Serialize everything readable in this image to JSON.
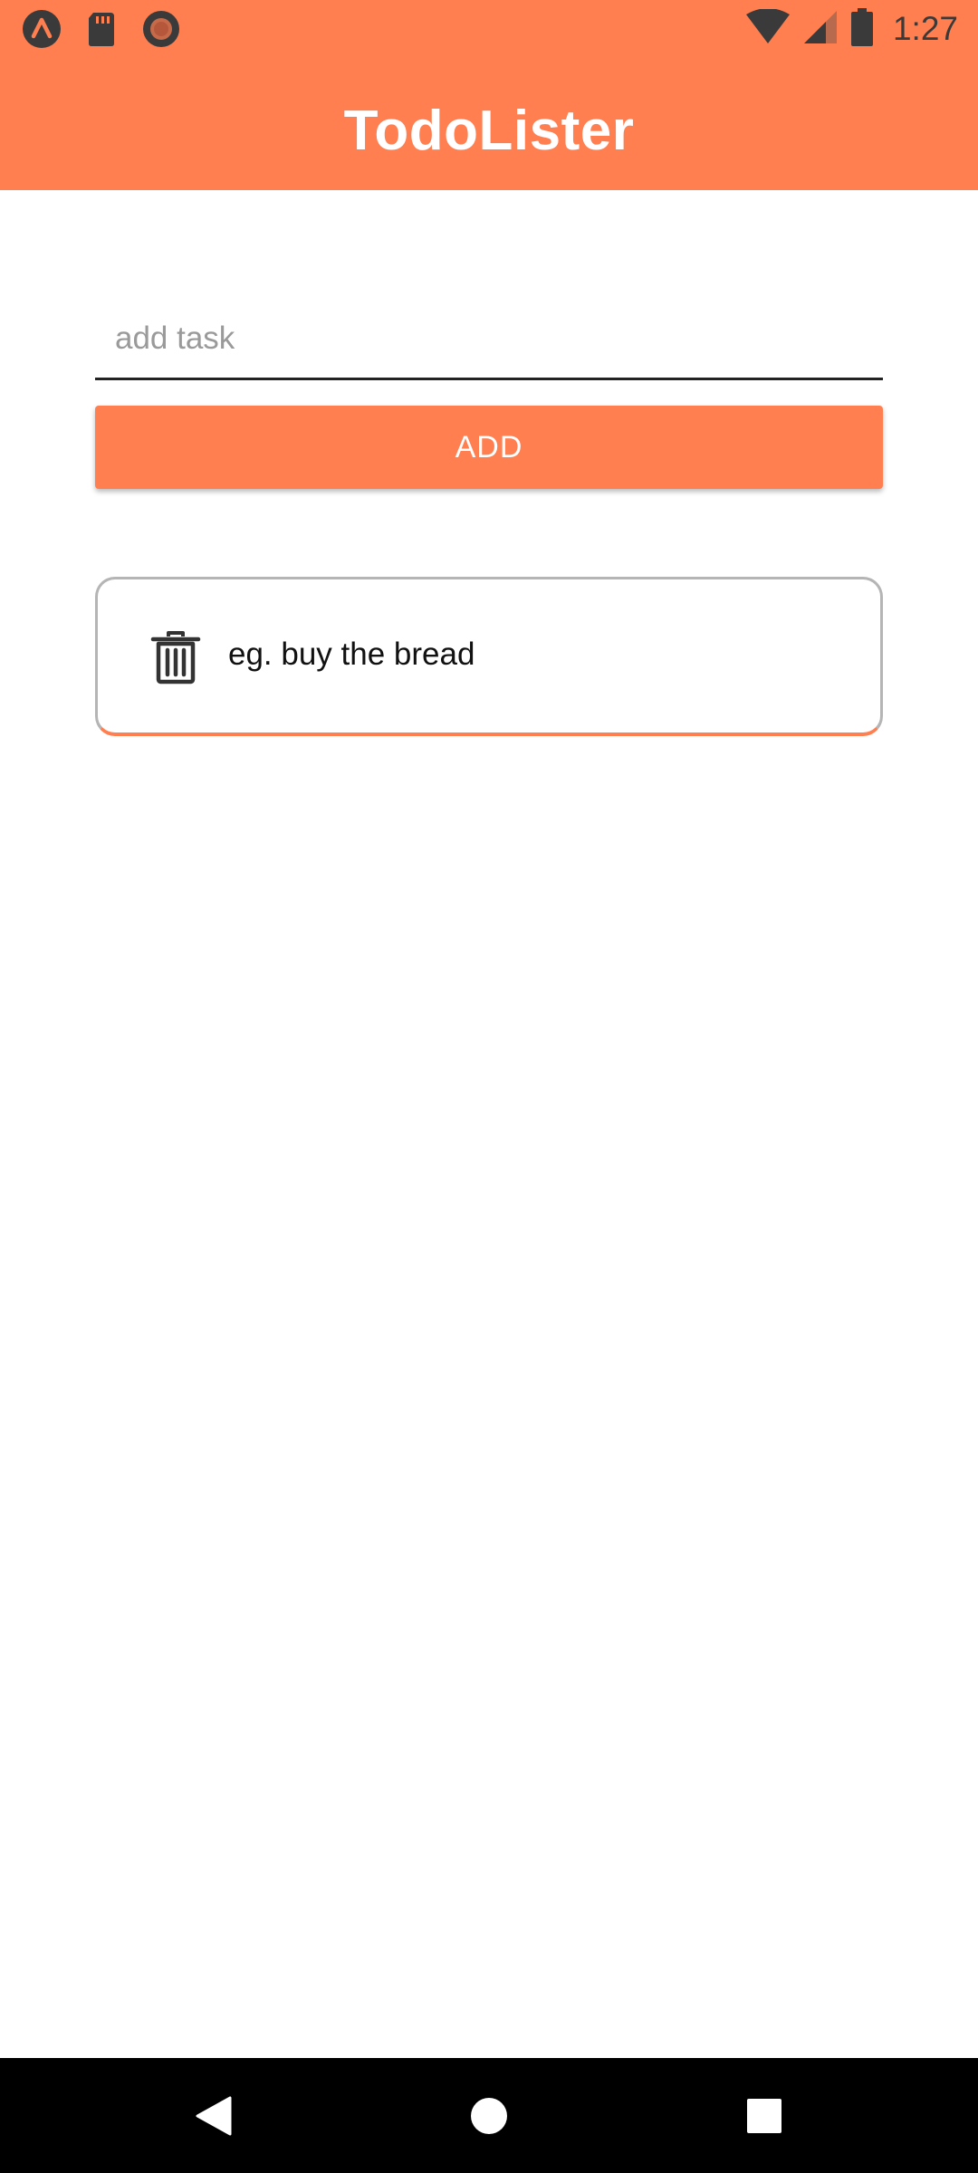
{
  "status_bar": {
    "time": "1:27",
    "left_icons": [
      "app-notification-icon",
      "sd-card-icon",
      "record-icon"
    ],
    "right_icons": [
      "wifi-icon",
      "cell-signal-icon",
      "battery-icon"
    ]
  },
  "app_bar": {
    "title": "TodoLister"
  },
  "task_input": {
    "value": "",
    "placeholder": "add task"
  },
  "add_button": {
    "label": "ADD"
  },
  "tasks": [
    {
      "text": "eg. buy the bread",
      "icon": "trash-icon"
    }
  ],
  "nav_bar": {
    "buttons": [
      "back-icon",
      "home-icon",
      "recent-apps-icon"
    ]
  },
  "colors": {
    "accent": "#ff7f50",
    "status_icons": "#3a3a3a",
    "card_border": "#b5b5b5",
    "nav_bar": "#000000"
  }
}
